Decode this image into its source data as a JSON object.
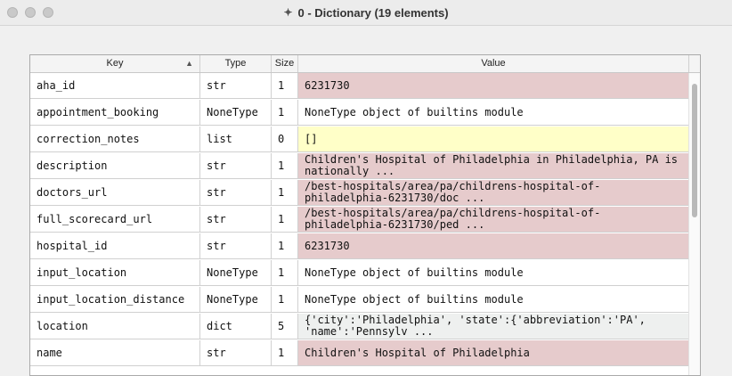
{
  "window": {
    "title": "0 - Dictionary (19 elements)",
    "title_icon": "✦"
  },
  "colors": {
    "number_or_string": "#e6cbcc",
    "none": "#ffffff",
    "list": "#ffffc8",
    "dict": "#eef0ef"
  },
  "columns": {
    "key": "Key",
    "type": "Type",
    "size": "Size",
    "value": "Value",
    "sort_indicator": "▲"
  },
  "rows": [
    {
      "key": "aha_id",
      "type": "str",
      "size": "1",
      "value": "6231730",
      "kind": "number_or_string"
    },
    {
      "key": "appointment_booking",
      "type": "NoneType",
      "size": "1",
      "value": "NoneType object of builtins module",
      "kind": "none"
    },
    {
      "key": "correction_notes",
      "type": "list",
      "size": "0",
      "value": "[]",
      "kind": "list"
    },
    {
      "key": "description",
      "type": "str",
      "size": "1",
      "value": "Children's Hospital of Philadelphia in Philadelphia, PA is\nnationally ...",
      "kind": "number_or_string"
    },
    {
      "key": "doctors_url",
      "type": "str",
      "size": "1",
      "value": "/best-hospitals/area/pa/childrens-hospital-of-\nphiladelphia-6231730/doc ...",
      "kind": "number_or_string"
    },
    {
      "key": "full_scorecard_url",
      "type": "str",
      "size": "1",
      "value": "/best-hospitals/area/pa/childrens-hospital-of-\nphiladelphia-6231730/ped ...",
      "kind": "number_or_string"
    },
    {
      "key": "hospital_id",
      "type": "str",
      "size": "1",
      "value": "6231730",
      "kind": "number_or_string"
    },
    {
      "key": "input_location",
      "type": "NoneType",
      "size": "1",
      "value": "NoneType object of builtins module",
      "kind": "none"
    },
    {
      "key": "input_location_distance",
      "type": "NoneType",
      "size": "1",
      "value": "NoneType object of builtins module",
      "kind": "none"
    },
    {
      "key": "location",
      "type": "dict",
      "size": "5",
      "value": "{'city':'Philadelphia', 'state':{'abbreviation':'PA',\n'name':'Pennsylv ...",
      "kind": "dict"
    },
    {
      "key": "name",
      "type": "str",
      "size": "1",
      "value": "Children's Hospital of Philadelphia",
      "kind": "number_or_string"
    }
  ]
}
